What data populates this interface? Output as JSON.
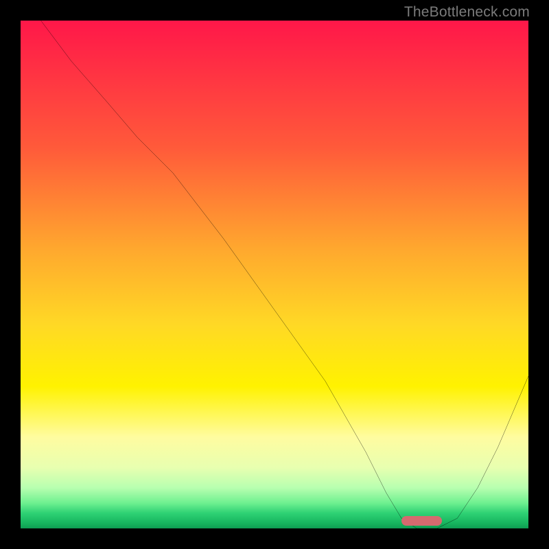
{
  "watermark": {
    "text": "TheBottleneck.com"
  },
  "chart_data": {
    "type": "line",
    "title": "",
    "xlabel": "",
    "ylabel": "",
    "xlim": [
      0,
      100
    ],
    "ylim": [
      0,
      100
    ],
    "grid": false,
    "series": [
      {
        "name": "bottleneck-curve",
        "x": [
          4,
          10,
          17,
          23,
          30,
          40,
          50,
          60,
          68,
          72,
          75,
          78,
          82,
          86,
          90,
          94,
          100
        ],
        "values": [
          100,
          92,
          84,
          77,
          70,
          57,
          43,
          29,
          15,
          7,
          2,
          0,
          0,
          2,
          8,
          16,
          30
        ]
      }
    ],
    "marker": {
      "x_start": 75,
      "x_end": 83,
      "y": 0,
      "color": "#d56a6f"
    },
    "background": {
      "type": "vertical-gradient",
      "stops": [
        {
          "pos": 0,
          "color": "#ff1749"
        },
        {
          "pos": 25,
          "color": "#ff5a3a"
        },
        {
          "pos": 45,
          "color": "#ffa82e"
        },
        {
          "pos": 60,
          "color": "#ffd925"
        },
        {
          "pos": 72,
          "color": "#fff200"
        },
        {
          "pos": 82,
          "color": "#fffca0"
        },
        {
          "pos": 88,
          "color": "#e8ffb0"
        },
        {
          "pos": 92,
          "color": "#b8ffb0"
        },
        {
          "pos": 95,
          "color": "#6ef090"
        },
        {
          "pos": 97,
          "color": "#2ed174"
        },
        {
          "pos": 99,
          "color": "#16b45e"
        },
        {
          "pos": 100,
          "color": "#0e9c52"
        }
      ]
    }
  }
}
